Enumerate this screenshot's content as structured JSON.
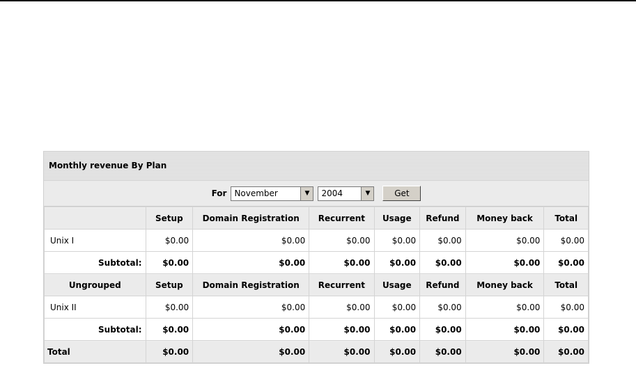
{
  "panel": {
    "title": "Monthly revenue By Plan"
  },
  "filter": {
    "label": "For",
    "month": "November",
    "year": "2004",
    "get_label": "Get"
  },
  "columns": [
    "Setup",
    "Domain Registration",
    "Recurrent",
    "Usage",
    "Refund",
    "Money back",
    "Total"
  ],
  "groups": [
    {
      "name": "",
      "rows": [
        {
          "name": "Unix I",
          "values": [
            "$0.00",
            "$0.00",
            "$0.00",
            "$0.00",
            "$0.00",
            "$0.00",
            "$0.00"
          ]
        }
      ],
      "subtotal_label": "Subtotal:",
      "subtotal": [
        "$0.00",
        "$0.00",
        "$0.00",
        "$0.00",
        "$0.00",
        "$0.00",
        "$0.00"
      ]
    },
    {
      "name": "Ungrouped",
      "rows": [
        {
          "name": "Unix II",
          "values": [
            "$0.00",
            "$0.00",
            "$0.00",
            "$0.00",
            "$0.00",
            "$0.00",
            "$0.00"
          ]
        }
      ],
      "subtotal_label": "Subtotal:",
      "subtotal": [
        "$0.00",
        "$0.00",
        "$0.00",
        "$0.00",
        "$0.00",
        "$0.00",
        "$0.00"
      ]
    }
  ],
  "total": {
    "label": "Total",
    "values": [
      "$0.00",
      "$0.00",
      "$0.00",
      "$0.00",
      "$0.00",
      "$0.00",
      "$0.00"
    ]
  }
}
